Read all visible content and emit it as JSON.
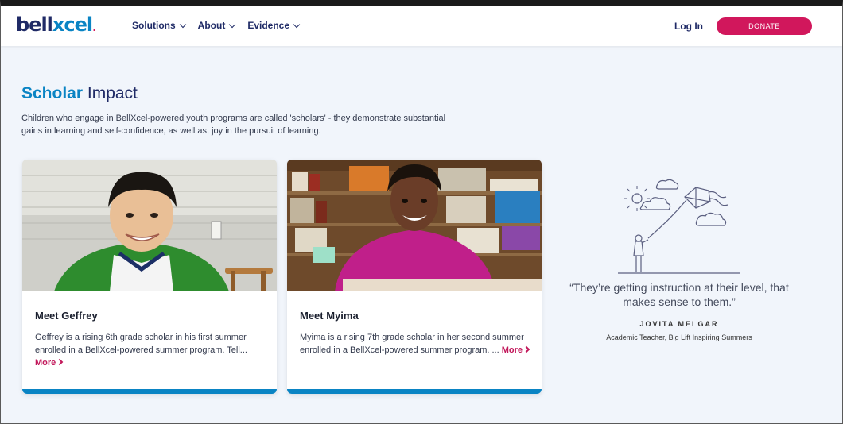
{
  "header": {
    "logo": {
      "part1": "bell",
      "part2": "xcel",
      "mark": "."
    },
    "nav": [
      {
        "label": "Solutions"
      },
      {
        "label": "About"
      },
      {
        "label": "Evidence"
      }
    ],
    "login_label": "Log In",
    "donate_label": "DONATE"
  },
  "section": {
    "title_accent": "Scholar",
    "title_rest": "Impact",
    "intro": "Children who engage in BellXcel-powered youth programs are called 'scholars' - they demonstrate substantial gains in learning and self-confidence, as well as, joy in the pursuit of learning."
  },
  "cards": [
    {
      "name": "Meet Geffrey",
      "text": "Geffrey is a rising 6th grade scholar in his first summer enrolled in a BellXcel-powered summer program. Tell...",
      "more": "More"
    },
    {
      "name": "Meet Myima",
      "text": "Myima is a rising 7th grade scholar in her second summer enrolled in a BellXcel-powered summer program.  ...",
      "more": "More"
    }
  ],
  "quote": {
    "text": "“They’re getting instruction at their level, that makes sense to them.”",
    "name": "JOVITA MELGAR",
    "role": "Academic Teacher, Big Lift Inspiring Summers"
  },
  "colors": {
    "brand_navy": "#1f2a66",
    "brand_blue": "#0a84c4",
    "brand_pink": "#d1175c"
  }
}
